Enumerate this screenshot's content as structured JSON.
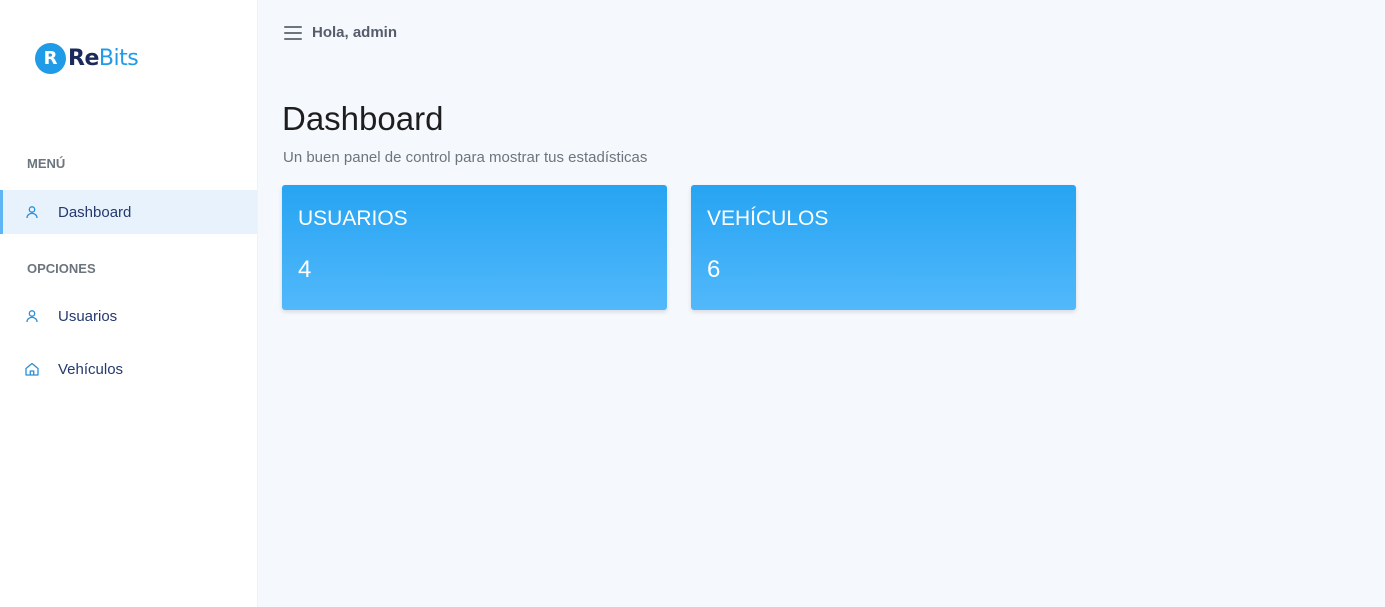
{
  "brand": {
    "logo_letter": "R",
    "name_part1": "Re",
    "name_part2": "Bits"
  },
  "sidebar": {
    "sections": [
      {
        "title": "MENÚ"
      },
      {
        "title": "OPCIONES"
      }
    ],
    "items": [
      {
        "label": "Dashboard",
        "icon": "user-icon",
        "active": true
      },
      {
        "label": "Usuarios",
        "icon": "user-icon",
        "active": false
      },
      {
        "label": "Vehículos",
        "icon": "home-icon",
        "active": false
      }
    ]
  },
  "header": {
    "greeting": "Hola, admin"
  },
  "main": {
    "title": "Dashboard",
    "subtitle": "Un buen panel de control para mostrar tus estadísticas",
    "cards": [
      {
        "title": "USUARIOS",
        "value": "4"
      },
      {
        "title": "VEHÍCULOS",
        "value": "6"
      }
    ]
  },
  "colors": {
    "accent": "#1f9be8",
    "card_top": "#26a4f2",
    "card_bottom": "#52b8fb",
    "active_bg": "#e7f2fd"
  }
}
